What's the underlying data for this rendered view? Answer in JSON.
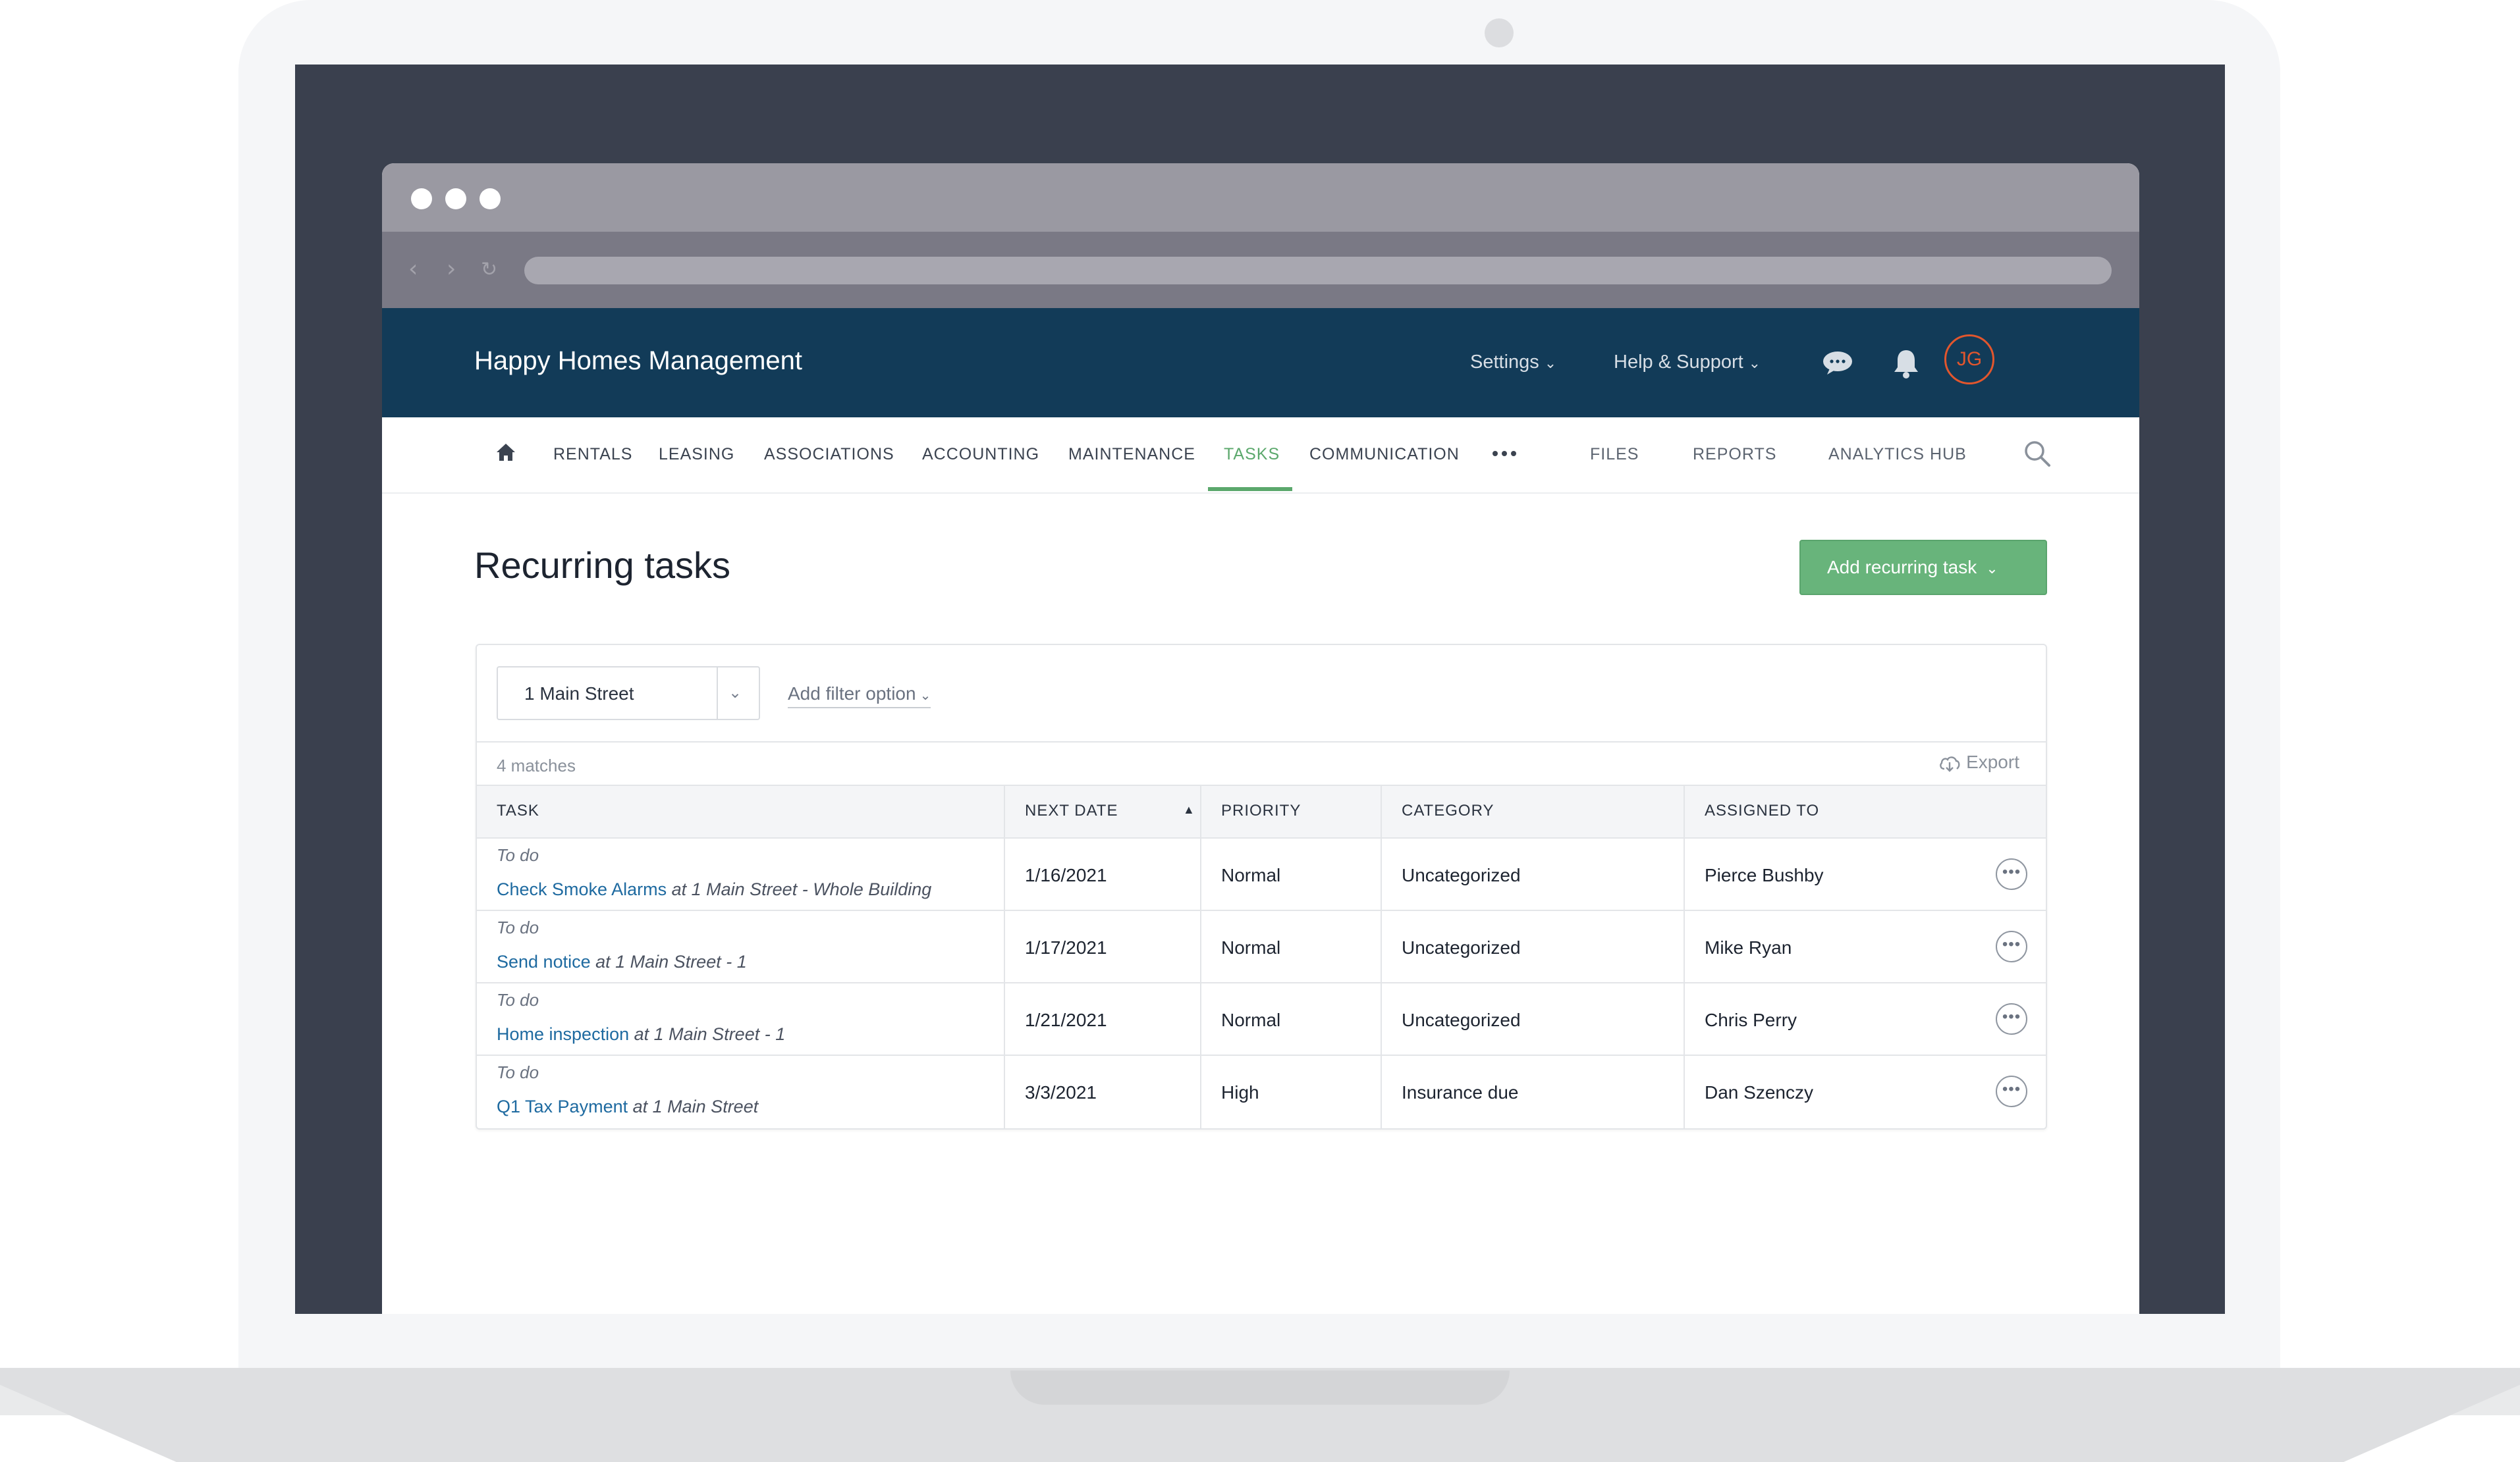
{
  "app": {
    "title": "Happy Homes Management",
    "header_menus": [
      "Settings",
      "Help & Support"
    ],
    "avatar_initials": "JG",
    "accent_color": "#5ba86c",
    "header_color": "#123b58",
    "avatar_color": "#e2562d"
  },
  "nav": {
    "items": [
      "RENTALS",
      "LEASING",
      "ASSOCIATIONS",
      "ACCOUNTING",
      "MAINTENANCE",
      "TASKS",
      "COMMUNICATION",
      "FILES",
      "REPORTS",
      "ANALYTICS HUB"
    ],
    "active": "TASKS"
  },
  "page": {
    "title": "Recurring tasks",
    "add_button": "Add recurring task"
  },
  "filters": {
    "property": "1 Main Street",
    "add_filter": "Add filter option"
  },
  "results": {
    "count_label": "4 matches",
    "export_label": "Export"
  },
  "table": {
    "columns": [
      "TASK",
      "NEXT DATE",
      "PRIORITY",
      "CATEGORY",
      "ASSIGNED TO"
    ],
    "sorted_column": "NEXT DATE",
    "rows": [
      {
        "status": "To do",
        "task": "Check Smoke Alarms",
        "location": "at 1 Main Street - Whole Building",
        "next_date": "1/16/2021",
        "priority": "Normal",
        "category": "Uncategorized",
        "assigned_to": "Pierce Bushby"
      },
      {
        "status": "To do",
        "task": "Send notice",
        "location": "at 1 Main Street - 1",
        "next_date": "1/17/2021",
        "priority": "Normal",
        "category": "Uncategorized",
        "assigned_to": "Mike Ryan"
      },
      {
        "status": "To do",
        "task": "Home inspection",
        "location": "at 1 Main Street - 1",
        "next_date": "1/21/2021",
        "priority": "Normal",
        "category": "Uncategorized",
        "assigned_to": "Chris Perry"
      },
      {
        "status": "To do",
        "task": "Q1 Tax Payment",
        "location": "at 1 Main Street",
        "next_date": "3/3/2021",
        "priority": "High",
        "category": "Insurance due",
        "assigned_to": "Dan Szenczy"
      }
    ]
  }
}
